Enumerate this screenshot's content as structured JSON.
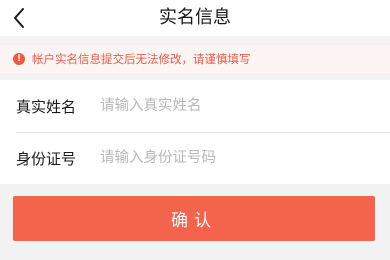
{
  "nav": {
    "back_icon": "chevron-left-icon",
    "title": "实名信息"
  },
  "notice": {
    "icon": "exclamation-circle-icon",
    "icon_glyph": "!",
    "text": "帐户实名信息提交后无法修改，请谨慎填写",
    "color": "#ec5a44"
  },
  "form": {
    "name": {
      "label": "真实姓名",
      "value": "",
      "placeholder": "请输入真实姓名"
    },
    "id_number": {
      "label": "身份证号",
      "value": "",
      "placeholder": "请输入身份证号码"
    }
  },
  "confirm": {
    "label": "确认",
    "color": "#f4634c"
  }
}
